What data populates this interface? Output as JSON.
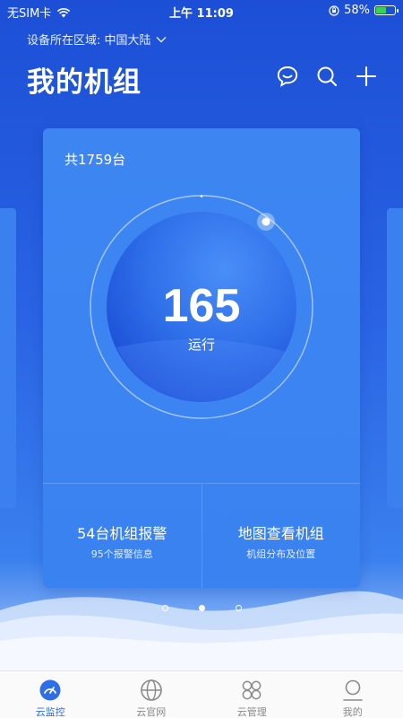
{
  "status_bar": {
    "carrier": "无SIM卡",
    "time": "上午 11:09",
    "battery": "58%",
    "battery_level": 0.58
  },
  "header": {
    "region_label": "设备所在区域: 中国大陆",
    "title": "我的机组",
    "icons": [
      "chat-icon",
      "search-icon",
      "add-icon"
    ]
  },
  "card": {
    "total_label": "共1759台",
    "gauge": {
      "value": "165",
      "label": "运行"
    },
    "actions": [
      {
        "title": "54台机组报警",
        "subtitle": "95个报警信息"
      },
      {
        "title": "地图查看机组",
        "subtitle": "机组分布及位置"
      }
    ]
  },
  "pager": {
    "count": 3,
    "active_index": 1
  },
  "tabbar": {
    "items": [
      {
        "label": "云监控",
        "icon": "gauge-icon",
        "active": true
      },
      {
        "label": "云官网",
        "icon": "globe-icon",
        "active": false
      },
      {
        "label": "云管理",
        "icon": "grid-icon",
        "active": false
      },
      {
        "label": "我的",
        "icon": "person-icon",
        "active": false
      }
    ]
  },
  "colors": {
    "primary": "#2a64e4",
    "card": "#3a82f0",
    "tab_active": "#2e6fe8",
    "tab_inactive": "#8a8a8a"
  }
}
